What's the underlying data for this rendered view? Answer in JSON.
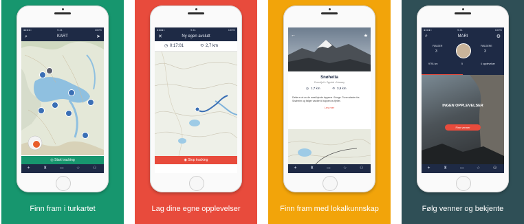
{
  "captions": [
    "Finn fram i turkartet",
    "Lag dine egne opplevelser",
    "Finn fram med lokalkunnskap",
    "Følg venner og bekjente"
  ],
  "colors": {
    "green": "#17966e",
    "red": "#e84b3c",
    "orange": "#f2a40a",
    "slate": "#2f4f56",
    "navy": "#1e2a45"
  },
  "screen1": {
    "title": "KART",
    "action": "Start tracking",
    "search_icon": "search-icon",
    "locate_icon": "location-arrow-icon"
  },
  "screen2": {
    "title": "Ny egen avslutt",
    "close_icon": "close-icon",
    "time": "0:17:01",
    "distance": "2,7 km",
    "action": "Stop tracking"
  },
  "screen3": {
    "place": "Snøhetta",
    "region": "Dovrefjell • Oppdal • Norway",
    "dist1": "1,7 km",
    "dist2": "3,9 km",
    "body": "Dette er et av de mest kjente toppene i Norge. Turen starter fra Snøheim og følger varden til toppen av fjellet.",
    "link": "Les mer"
  },
  "screen4": {
    "name": "MARI",
    "followers_label": "FØLGER",
    "following_label": "FØLGERE",
    "followers": "3",
    "following": "3",
    "stat1": "9791 km",
    "stat2": "5",
    "stat3": "4 opplevelser",
    "hero_title": "INGEN OPPLEVELSER",
    "button": "Finn venner"
  },
  "tabs": [
    "tracks-icon",
    "backpack-icon",
    "map-icon",
    "star-icon",
    "user-icon"
  ]
}
